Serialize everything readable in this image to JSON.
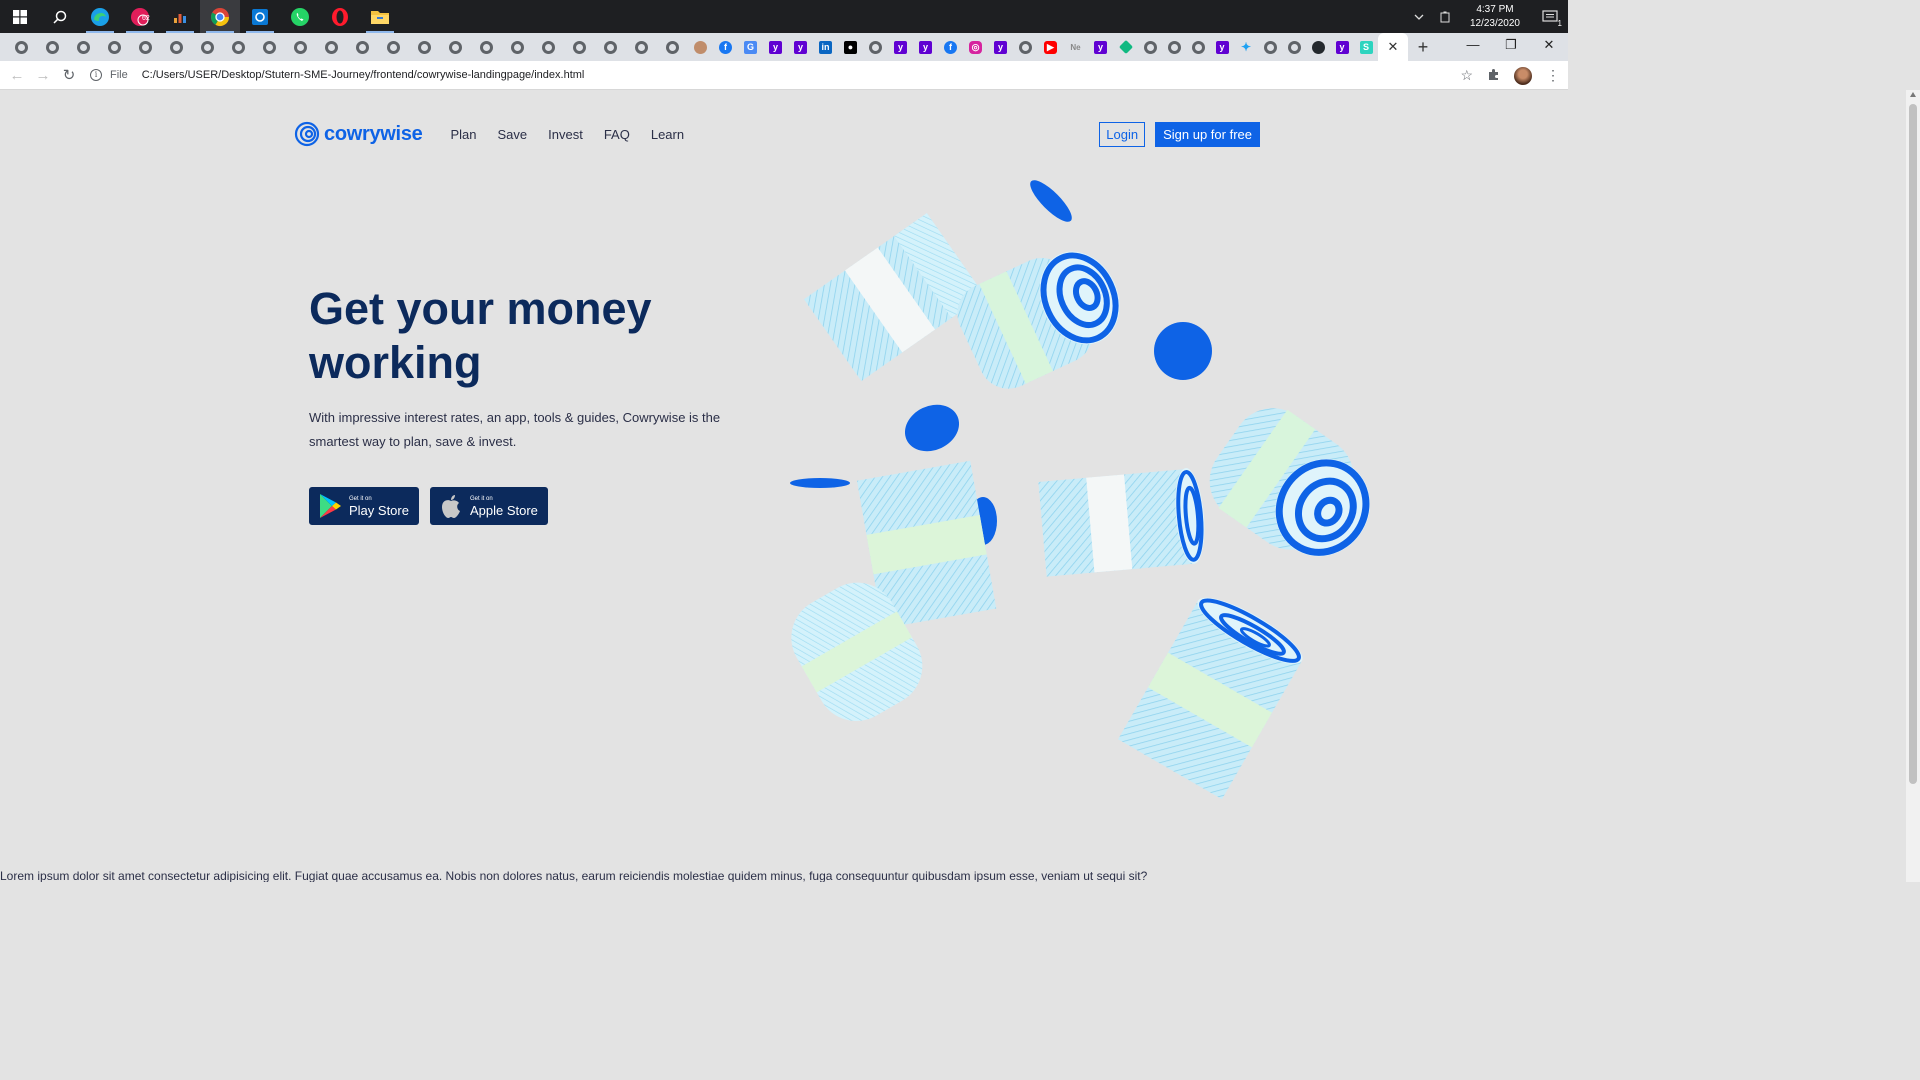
{
  "taskbar": {
    "apps": [
      "windows-start-icon",
      "search-icon",
      "edge-icon",
      "slack-icon",
      "chart-app-icon",
      "chrome-icon",
      "outlook-icon",
      "whatsapp-icon",
      "opera-icon",
      "file-explorer-icon"
    ],
    "slack_badge": "62",
    "time": "4:37 PM",
    "date": "12/23/2020",
    "notification_count": "1"
  },
  "browser": {
    "address": "C:/Users/USER/Desktop/Stutern-SME-Journey/frontend/cowrywise-landingpage/index.html",
    "file_label": "File",
    "new_tab_label": "+",
    "close_tab_label": "✕"
  },
  "nav": {
    "logo": "cowrywise",
    "links": [
      "Plan",
      "Save",
      "Invest",
      "FAQ",
      "Learn"
    ],
    "login": "Login",
    "signup": "Sign up for free"
  },
  "hero": {
    "title": "Get your money working",
    "text": "With impressive interest rates, an app, tools & guides, Cowrywise is the smartest way to plan, save & invest.",
    "play_small": "Get it on",
    "play_big": "Play Store",
    "apple_small": "Get it on",
    "apple_big": "Apple Store"
  },
  "footer": {
    "text": "Lorem ipsum dolor sit amet consectetur adipisicing elit. Fugiat quae accusamus ea. Nobis non dolores natus, earum reiciendis molestiae quidem minus, fuga consequuntur quibusdam ipsum esse, veniam ut sequi sit?"
  },
  "colors": {
    "brand_blue": "#0e63e6",
    "navy": "#0c2a5c",
    "page_bg": "#e3e3e3"
  }
}
